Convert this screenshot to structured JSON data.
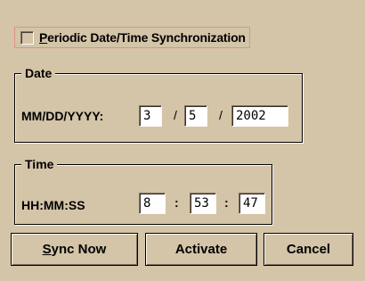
{
  "sync_checkbox": {
    "checked": false,
    "label_mnemonic": "P",
    "label_rest": "eriodic Date/Time Synchronization"
  },
  "date_group": {
    "title": "Date",
    "format_label": "MM/DD/YYYY:",
    "month": "3",
    "day": "5",
    "year": "2002",
    "separator": "/"
  },
  "time_group": {
    "title": "Time",
    "format_label": "HH:MM:SS",
    "hour": "8",
    "minute": "53",
    "second": "47",
    "separator": ":"
  },
  "buttons": {
    "sync_now_mnemonic": "S",
    "sync_now_rest": "ync Now",
    "activate": "Activate",
    "cancel": "Cancel"
  }
}
